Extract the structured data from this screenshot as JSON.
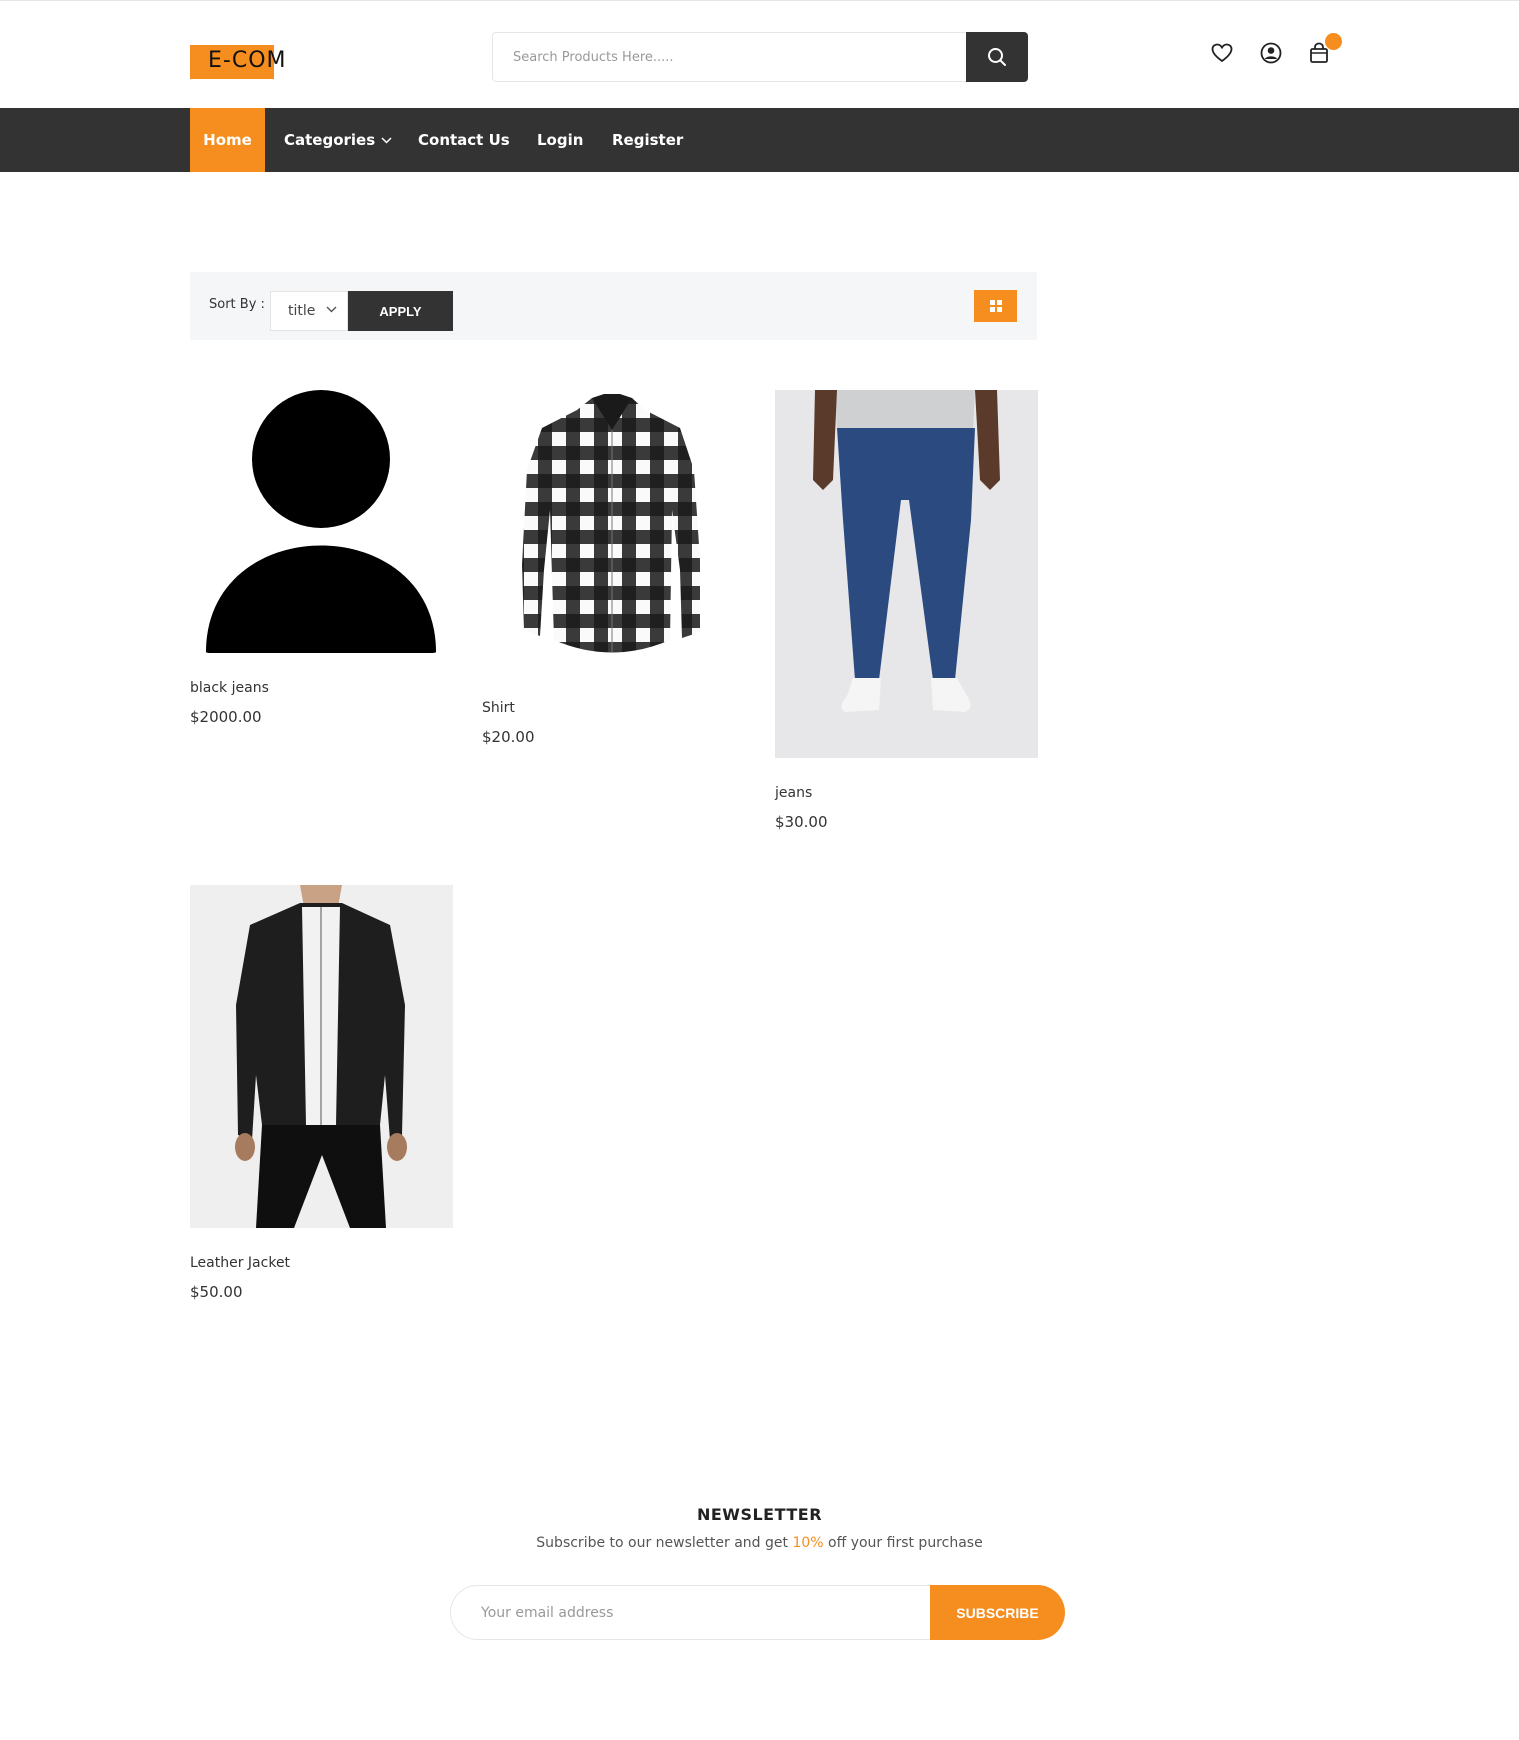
{
  "header": {
    "logo_text": "E-COM",
    "search_placeholder": "Search Products Here.....",
    "icons": [
      "search-icon",
      "heart-icon",
      "user-icon",
      "cart-icon"
    ]
  },
  "nav": {
    "items": [
      {
        "label": "Home",
        "active": true
      },
      {
        "label": "Categories",
        "has_dropdown": true
      },
      {
        "label": "Contact Us"
      },
      {
        "label": "Login"
      },
      {
        "label": "Register"
      }
    ]
  },
  "toolbar": {
    "sort_label": "Sort By :",
    "sort_value": "title",
    "apply_label": "APPLY",
    "view_icon": "grid-icon"
  },
  "products": [
    {
      "name": "black jeans",
      "price": "$2000.00",
      "image": "user-placeholder"
    },
    {
      "name": "Shirt",
      "price": "$20.00",
      "image": "plaid-shirt"
    },
    {
      "name": "jeans",
      "price": "$30.00",
      "image": "blue-jeans"
    },
    {
      "name": "Leather Jacket",
      "price": "$50.00",
      "image": "leather-jacket"
    }
  ],
  "newsletter": {
    "title": "NEWSLETTER",
    "subtitle_before": "Subscribe to our newsletter and get ",
    "subtitle_highlight": "10%",
    "subtitle_after": " off your first purchase",
    "email_placeholder": "Your email address",
    "button_label": "SUBSCRIBE"
  },
  "colors": {
    "accent": "#f68e1f",
    "dark": "#333333",
    "toolbar_bg": "#f5f6f8"
  }
}
